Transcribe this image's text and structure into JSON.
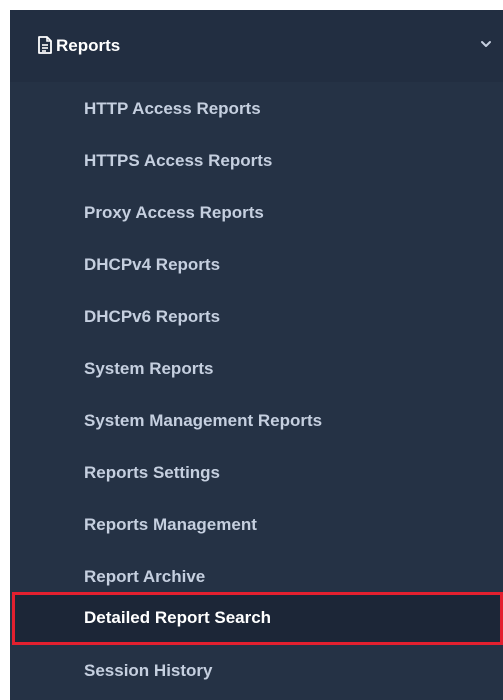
{
  "section": {
    "title": "Reports",
    "icon": "document-icon",
    "expanded_icon": "chevron-down-icon"
  },
  "menu": {
    "items": [
      {
        "label": "HTTP Access Reports"
      },
      {
        "label": "HTTPS Access Reports"
      },
      {
        "label": "Proxy Access Reports"
      },
      {
        "label": "DHCPv4 Reports"
      },
      {
        "label": "DHCPv6 Reports"
      },
      {
        "label": "System Reports"
      },
      {
        "label": "System Management Reports"
      },
      {
        "label": "Reports Settings"
      },
      {
        "label": "Reports Management"
      },
      {
        "label": "Report Archive"
      },
      {
        "label": "Detailed Report Search",
        "active": true
      },
      {
        "label": "Session History"
      }
    ]
  },
  "colors": {
    "sidebar_bg": "#253245",
    "header_bg": "#222e41",
    "item_text": "#c5cfdf",
    "active_text": "#ffffff",
    "active_bg": "#1c2637",
    "highlight_border": "#e3202f"
  }
}
